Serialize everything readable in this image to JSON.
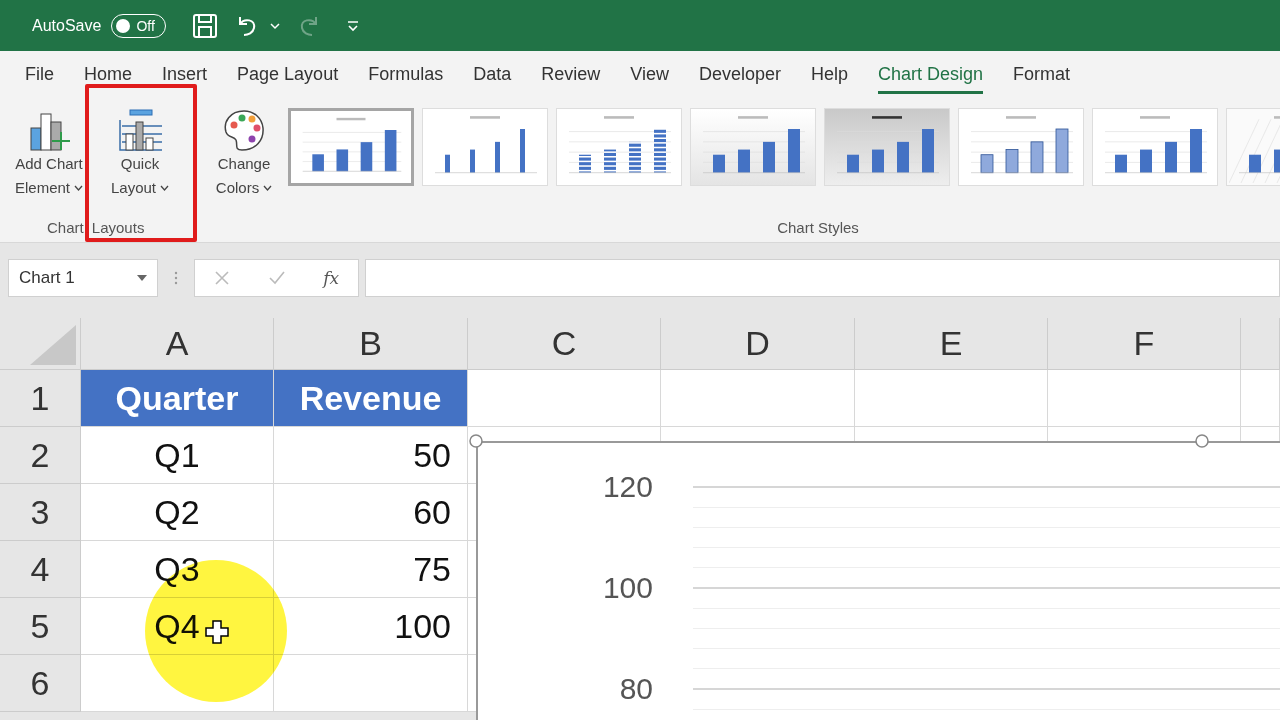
{
  "title_bar": {
    "autosave_label": "AutoSave",
    "autosave": {
      "on": false,
      "label": "Off"
    },
    "redo_disabled": true
  },
  "tabs": [
    {
      "label": "File",
      "selected": false
    },
    {
      "label": "Home",
      "selected": false
    },
    {
      "label": "Insert",
      "selected": false
    },
    {
      "label": "Page Layout",
      "selected": false
    },
    {
      "label": "Formulas",
      "selected": false
    },
    {
      "label": "Data",
      "selected": false
    },
    {
      "label": "Review",
      "selected": false
    },
    {
      "label": "View",
      "selected": false
    },
    {
      "label": "Developer",
      "selected": false
    },
    {
      "label": "Help",
      "selected": false
    },
    {
      "label": "Chart Design",
      "selected": true
    },
    {
      "label": "Format",
      "selected": false
    }
  ],
  "ribbon": {
    "chart_layouts": {
      "label": "Chart Layouts",
      "buttons": [
        {
          "kind": "add-element",
          "lines": [
            "Add Chart",
            "Element"
          ]
        },
        {
          "kind": "quick-layout",
          "lines": [
            "Quick",
            "Layout"
          ]
        }
      ]
    },
    "change_colors": {
      "lines": [
        "Change",
        "Colors"
      ]
    },
    "chart_styles": {
      "label": "Chart Styles",
      "styles": [
        {
          "kind": "plain",
          "selected": true
        },
        {
          "kind": "thin",
          "selected": false
        },
        {
          "kind": "striped",
          "selected": false
        },
        {
          "kind": "shaded",
          "selected": false
        },
        {
          "kind": "dark",
          "selected": false
        },
        {
          "kind": "outlined",
          "selected": false
        },
        {
          "kind": "plain",
          "selected": false
        },
        {
          "kind": "pattern",
          "selected": false
        }
      ]
    }
  },
  "formula_bar": {
    "name_box": "Chart 1",
    "fx": "fx"
  },
  "sheet": {
    "columns": [
      "A",
      "B",
      "C",
      "D",
      "E",
      "F"
    ],
    "rows": [
      {
        "header": "1",
        "kind": "header",
        "cells": [
          "Quarter",
          "Revenue"
        ]
      },
      {
        "header": "2",
        "kind": "data",
        "cells": [
          "Q1",
          "50"
        ]
      },
      {
        "header": "3",
        "kind": "data",
        "cells": [
          "Q2",
          "60"
        ]
      },
      {
        "header": "4",
        "kind": "data",
        "cells": [
          "Q3",
          "75"
        ]
      },
      {
        "header": "5",
        "kind": "data",
        "cells": [
          "Q4",
          "100"
        ]
      },
      {
        "header": "6"
      }
    ]
  },
  "chart": {
    "axis_labels": [
      "120",
      "100",
      "80"
    ]
  }
}
